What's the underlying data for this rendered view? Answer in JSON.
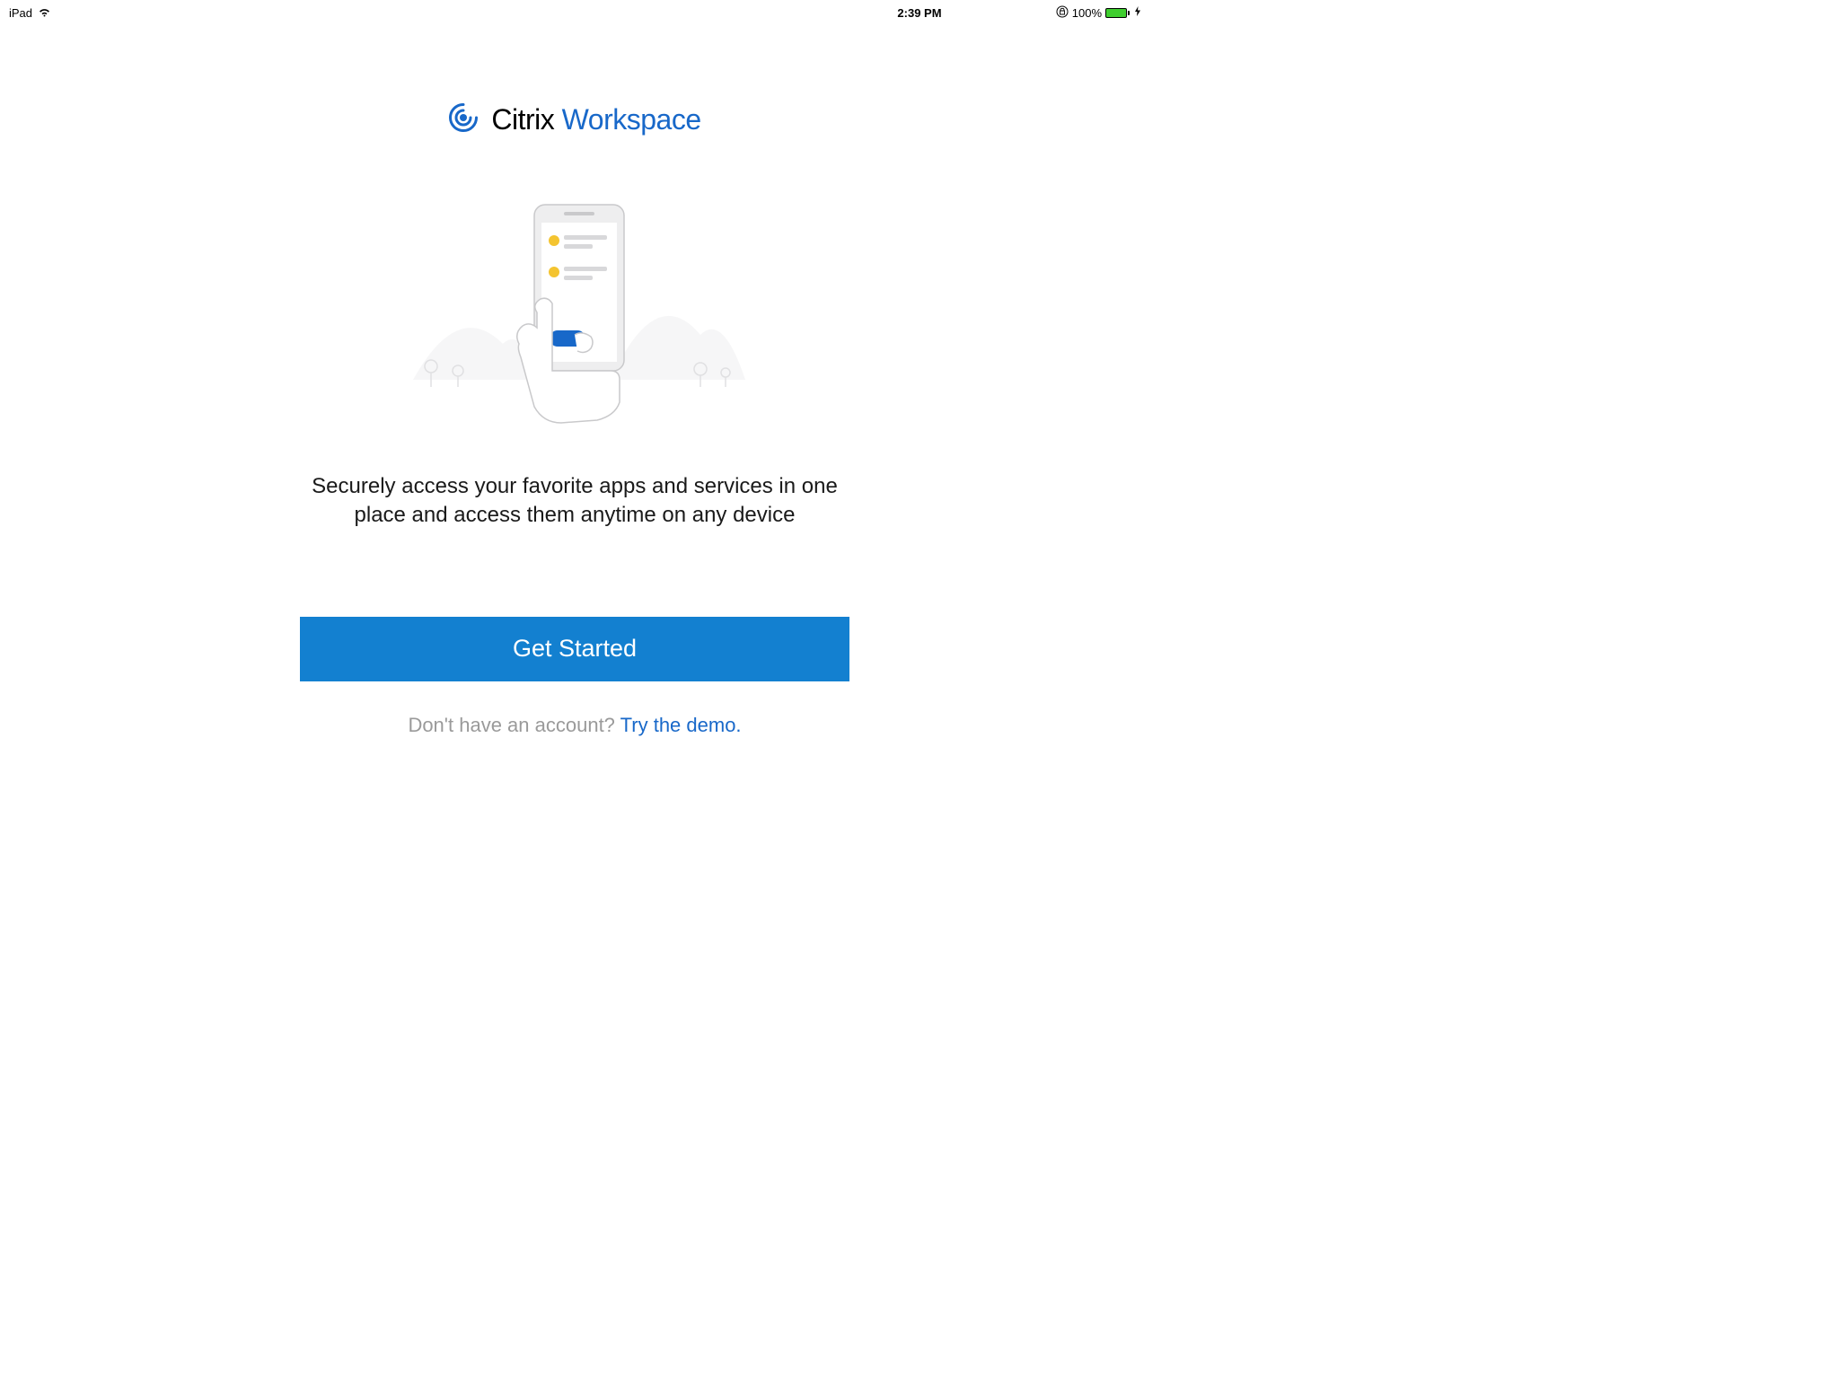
{
  "statusBar": {
    "device": "iPad",
    "time": "2:39 PM",
    "batteryPercent": "100%"
  },
  "brand": {
    "citrix": "Citrix",
    "workspace": "Workspace"
  },
  "description": "Securely access your favorite apps and services in one place and access them anytime on any device",
  "buttons": {
    "getStarted": "Get Started"
  },
  "demo": {
    "prompt": "Don't have an account? ",
    "link": "Try the demo."
  }
}
